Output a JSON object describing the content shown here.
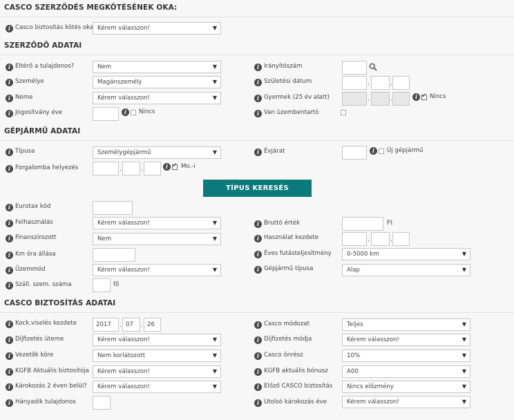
{
  "sections": {
    "reason": "CASCO SZERZŐDÉS MEGKÖTÉSÉNEK OKA:",
    "contract": "SZERZŐDŐ ADATAI",
    "vehicle": "GÉPJÁRMŰ ADATAI",
    "casco": "CASCO BIZTOSÍTÁS ADATAI"
  },
  "reason": {
    "label": "Casco biztosítás kötés oka",
    "value": "Kérem válasszon!"
  },
  "contract": {
    "different_owner": {
      "label": "Eltérő a tulajdonos?",
      "value": "Nem"
    },
    "person_type": {
      "label": "Személye",
      "value": "Magánszemély"
    },
    "gender": {
      "label": "Neme",
      "value": "Kérem válasszon!"
    },
    "license_year": {
      "label": "Jogosítvány éve",
      "value": "",
      "none_label": "Nincs"
    },
    "zip": {
      "label": "Irányítószám",
      "value": ""
    },
    "birth_date": {
      "label": "Születési dátum"
    },
    "children": {
      "label": "Gyermek (25 év alatt)",
      "none_label": "Nincs"
    },
    "operator": {
      "label": "Van üzembentartó"
    }
  },
  "vehicle": {
    "type": {
      "label": "Típusa",
      "value": "Személygépjármű"
    },
    "first_reg": {
      "label": "Forgalomba helyezés",
      "mo_label": "Mo.-i"
    },
    "year": {
      "label": "Évjárat",
      "new_label": "Új gépjármű"
    },
    "search_button": "TÍPUS KERESÉS",
    "eurotax": {
      "label": "Eurotax kód"
    },
    "usage": {
      "label": "Felhasználás",
      "value": "Kérem válasszon!"
    },
    "financed": {
      "label": "Finanszírozott",
      "value": "Nem"
    },
    "odometer": {
      "label": "Km óra állása"
    },
    "operation": {
      "label": "Üzemmód",
      "value": "Kérem válasszon!"
    },
    "seats": {
      "label": "Száll. szem. száma",
      "suffix": "fő"
    },
    "gross_value": {
      "label": "Bruttó érték",
      "suffix": "Ft"
    },
    "usage_start": {
      "label": "Használat kezdete"
    },
    "annual_km": {
      "label": "Éves futásteljesítmény",
      "value": "0-5000 km"
    },
    "vehicle_kind": {
      "label": "Gépjármű típusa",
      "value": "Alap"
    }
  },
  "casco": {
    "start": {
      "label": "Kock.viselés kezdete",
      "year": "2017",
      "month": "07",
      "day": "26"
    },
    "payment_freq": {
      "label": "Díjfizetés üteme",
      "value": "Kérem válasszon!"
    },
    "drivers": {
      "label": "Vezetők köre",
      "value": "Nem korlátozott"
    },
    "kgfb_insurer": {
      "label": "KGFB Aktuális biztosítója",
      "value": "Kérem válasszon!"
    },
    "claims": {
      "label": "Károkozás 2 éven belül?",
      "value": "Kérem válasszon!"
    },
    "nth_owner": {
      "label": "Hányadik tulajdonos"
    },
    "mode": {
      "label": "Casco módozat",
      "value": "Teljes"
    },
    "payment_method": {
      "label": "Díjfizetés módja",
      "value": "Kérem válasszon!"
    },
    "deductible": {
      "label": "Casco önrész",
      "value": "10%"
    },
    "kgfb_bonus": {
      "label": "KGFB aktuális bónusz",
      "value": "A00"
    },
    "prev_casco": {
      "label": "Előző CASCO biztosítás",
      "value": "Nincs előzmény"
    },
    "last_claim_year": {
      "label": "Utolsó károkozás éve",
      "value": "Kérem válasszon!"
    }
  },
  "glyphs": {
    "info": "i",
    "arrow": "▼"
  }
}
